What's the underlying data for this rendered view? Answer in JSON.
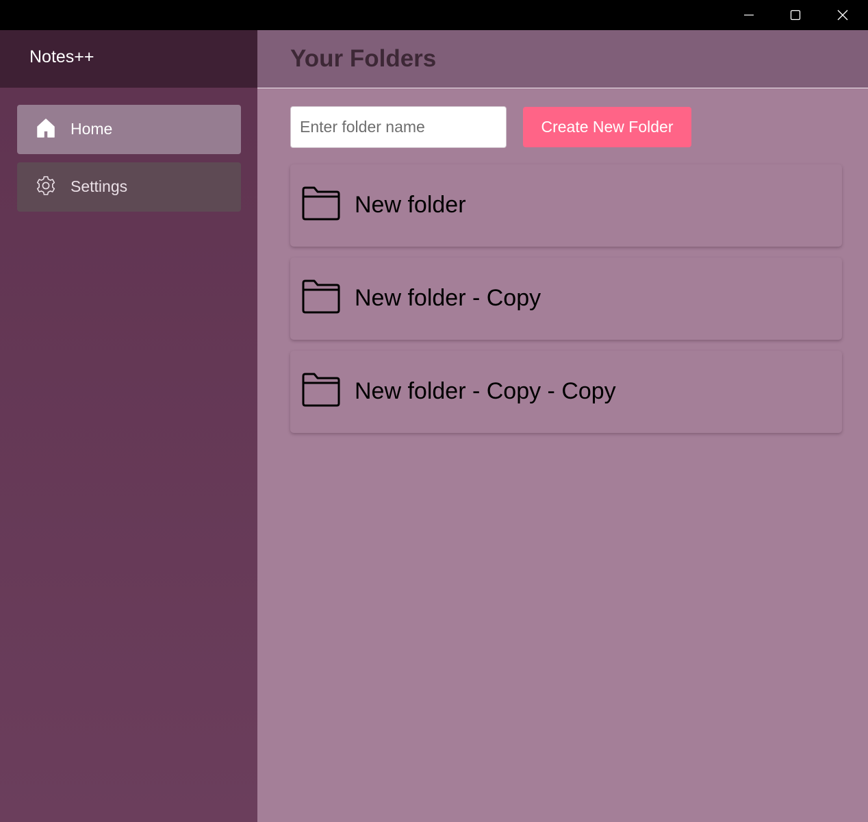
{
  "window": {
    "controls": [
      {
        "name": "minimize-button",
        "icon": "minimize-icon"
      },
      {
        "name": "maximize-button",
        "icon": "maximize-icon"
      },
      {
        "name": "close-button",
        "icon": "close-icon"
      }
    ]
  },
  "sidebar": {
    "app_title": "Notes++",
    "items": [
      {
        "label": "Home",
        "icon": "home-icon",
        "selected": true
      },
      {
        "label": "Settings",
        "icon": "gear-icon",
        "selected": false
      }
    ]
  },
  "main": {
    "title": "Your Folders",
    "folder_input": {
      "placeholder": "Enter folder name",
      "value": ""
    },
    "create_button_label": "Create New Folder",
    "folders": [
      {
        "name": "New folder",
        "icon": "folder-icon"
      },
      {
        "name": "New folder - Copy",
        "icon": "folder-icon"
      },
      {
        "name": "New folder - Copy - Copy",
        "icon": "folder-icon"
      }
    ]
  },
  "colors": {
    "sidebar_header": "#3e2034",
    "sidebar": "#5f3350",
    "main_header": "#805f79",
    "main": "#a47f98",
    "nav_selected": "#967d91",
    "nav_item": "#5e4a54",
    "accent_button": "#ff6487"
  }
}
